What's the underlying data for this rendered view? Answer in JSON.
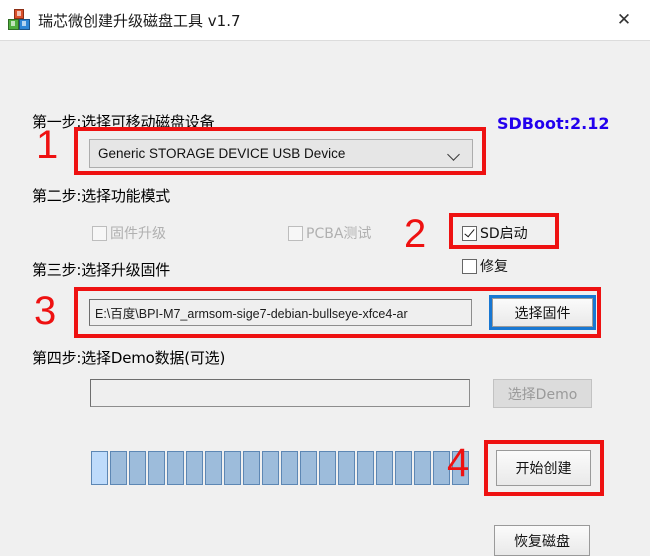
{
  "window": {
    "title": "瑞芯微创建升级磁盘工具 v1.7",
    "icon": "blocks-icon",
    "close_label": "✕"
  },
  "version_badge": "SDBoot:2.12",
  "steps": {
    "step1_label": "第一步:选择可移动磁盘设备",
    "step2_label": "第二步:选择功能模式",
    "step3_label": "第三步:选择升级固件",
    "step4_label": "第四步:选择Demo数据(可选)"
  },
  "device_combo": {
    "value": "Generic STORAGE DEVICE USB Device",
    "chevron": "chevron-down-icon"
  },
  "mode_checkboxes": [
    {
      "label": "固件升级",
      "checked": false,
      "disabled": true
    },
    {
      "label": "PCBA测试",
      "checked": false,
      "disabled": true
    },
    {
      "label": "SD启动",
      "checked": true,
      "disabled": false
    },
    {
      "label": "修复",
      "checked": false,
      "disabled": false
    }
  ],
  "firmware": {
    "path": "E:\\百度\\BPI-M7_armsom-sige7-debian-bullseye-xfce4-ar",
    "button_label": "选择固件"
  },
  "demo": {
    "value": "",
    "placeholder": "",
    "button_label": "选择Demo",
    "button_disabled": true
  },
  "progress": {
    "total_blocks": 20,
    "lead_index": 0
  },
  "actions": {
    "start_label": "开始创建",
    "restore_label": "恢复磁盘"
  },
  "annotations": [
    {
      "number": "1"
    },
    {
      "number": "2"
    },
    {
      "number": "3"
    },
    {
      "number": "4"
    }
  ],
  "colors": {
    "annotation_red": "#ee1111",
    "version_blue": "#2200ee",
    "progress_block": "#9dbcdb",
    "progress_lead": "#bedbfb",
    "focus_blue": "#1877d2"
  }
}
